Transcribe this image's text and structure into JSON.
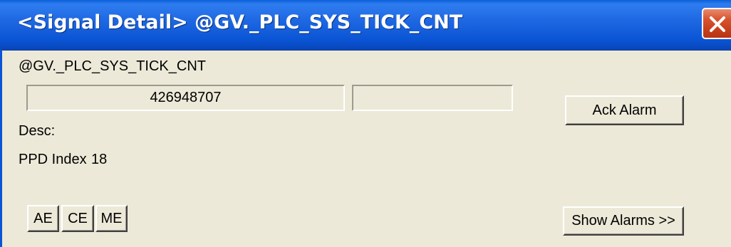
{
  "window": {
    "title": "<Signal Detail> @GV._PLC_SYS_TICK_CNT",
    "close_icon": "close-icon"
  },
  "signal": {
    "name": "@GV._PLC_SYS_TICK_CNT",
    "value": "426948707",
    "secondary_value": "",
    "desc_label": "Desc:",
    "ppd_label": "PPD Index",
    "ppd_value": "18"
  },
  "buttons": {
    "ack_alarm": "Ack Alarm",
    "show_alarms": "Show Alarms >>",
    "ae": "AE",
    "ce": "CE",
    "me": "ME"
  }
}
